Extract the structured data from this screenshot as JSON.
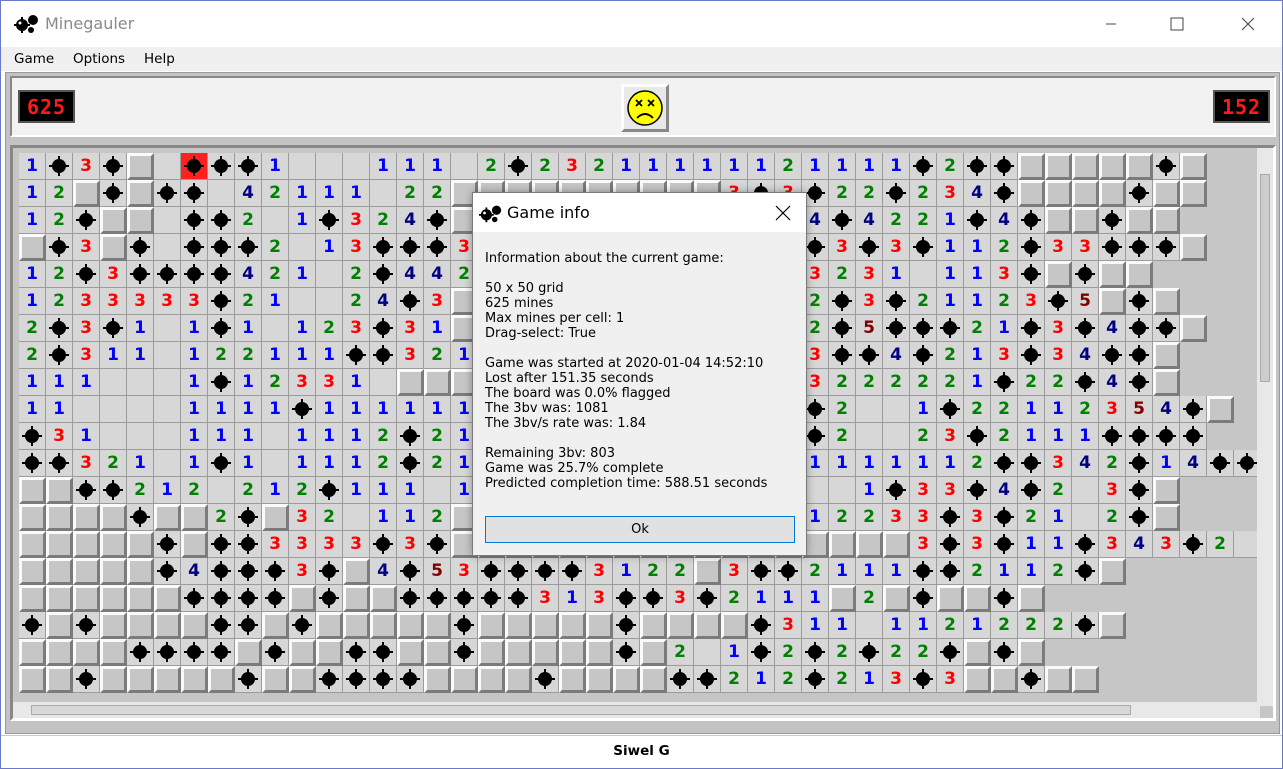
{
  "window": {
    "title": "Minegauler",
    "minimize_icon": "minimize-icon",
    "maximize_icon": "maximize-icon",
    "close_icon": "close-icon"
  },
  "menu": {
    "items": [
      "Game",
      "Options",
      "Help"
    ]
  },
  "counters": {
    "mines_remaining": "625",
    "timer": "152"
  },
  "face": {
    "state": "dead",
    "icon": "dead-face-icon"
  },
  "colors": {
    "1": "#0000ff",
    "2": "#008000",
    "3": "#ff0000",
    "4": "#000080",
    "5": "#800000",
    "lcd_text": "#ff1a1a",
    "accent": "#0078d7"
  },
  "board_view": {
    "legend": "digits = revealed number, . = revealed empty, * = mine, X = hit mine, # = unrevealed",
    "rows": [
      "1*3*#.X**1...111.2*23211111121111*2**#####*#",
      "12#*#**.42111.22##########3*3*22*234*####*##",
      "12*##.**2.1*324*##########4*54*4221*4*##*##",
      "#*3#*.***2.13***3##########3**3*3*112*33***#",
      "12*3****421.2*442#########3323231.113*#*##",
      "1233333*21..24*3##########*112*3*21123*5#*#",
      "2*3*1.1*1.123*31##########4*12*5***21*3*4**#",
      "2*311.122111**321##########313**4*213*34**#",
      "111...1*12331.###########*3*33222221*22*4*#",
      "11....1111*111111##########23*2..1*22112354*#",
      "*31...111.1112*21##########23*2..23*2111****",
      "**321.1*1.1112*21##########*21111112**342*14***",
      "##**212.212*111.1##########22..1*33*4*2.3*#",
      "####*##2*#32.112##########*2212233*3*21.2*#",
      "#####*#**3333*3*#################3*3*11*343*2.23**#",
      "#####*4***3*#4*53****3122#3**2111**2112*#",
      "######****#*##*****313**3*2111#2#*##*#",
      "*#*####**#*#####*#####*####*311.1121222*#",
      "####****#*##**##*#####*#2.1*2*2*22*#*#",
      "##*#####*##****####*####**212*213*3##*##"
    ]
  },
  "dialog": {
    "title": "Game info",
    "icon": "minegauler-icon",
    "close_icon": "close-icon",
    "intro": "Information about the current game:",
    "grid": "50 x 50 grid",
    "mines": "625 mines",
    "max_mines_per_cell": "Max mines per cell: 1",
    "drag_select": "Drag-select: True",
    "started": "Game was started at 2020-01-04 14:52:10",
    "lost_after": "Lost after 151.35 seconds",
    "flagged": "The board was 0.0% flagged",
    "bbbv": "The 3bv was: 1081",
    "bbbv_rate": "The 3bv/s rate was: 1.84",
    "remaining_bbbv": "Remaining 3bv: 803",
    "complete": "Game was 25.7% complete",
    "predicted": "Predicted completion time: 588.51 seconds",
    "ok_label": "Ok"
  },
  "status": {
    "player_name": "Siwel G"
  }
}
